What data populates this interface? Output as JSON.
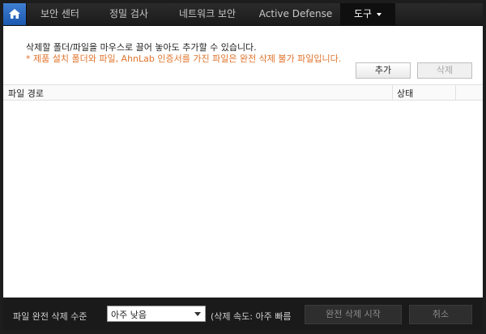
{
  "tabs": [
    {
      "label": "보안 센터"
    },
    {
      "label": "정밀 검사"
    },
    {
      "label": "네트워크 보안"
    },
    {
      "label": "Active Defense"
    },
    {
      "label": "도구"
    }
  ],
  "panel": {
    "info_line1": "삭제할 폴더/파일을 마우스로 끌어 놓아도 추가할 수 있습니다.",
    "info_line2": "* 제품 설치 폴더와 파일, AhnLab 인증서를 가진 파일은 완전 삭제 불가 파일입니다.",
    "add_label": "추가",
    "delete_label": "삭제"
  },
  "table": {
    "headers": [
      "파일 경로",
      "상태"
    ]
  },
  "bottom": {
    "level_label": "파일 완전 삭제 수준",
    "level_value": "아주 낮음",
    "speed_text": "(삭제 속도: 아주 빠름",
    "start_label": "완전 삭제 시작",
    "cancel_label": "취소"
  },
  "colors": {
    "accent": "#2a6cc4",
    "warning": "#e0732b"
  },
  "icons": {
    "home": "home-icon",
    "dropdown": "chevron-down-icon"
  }
}
